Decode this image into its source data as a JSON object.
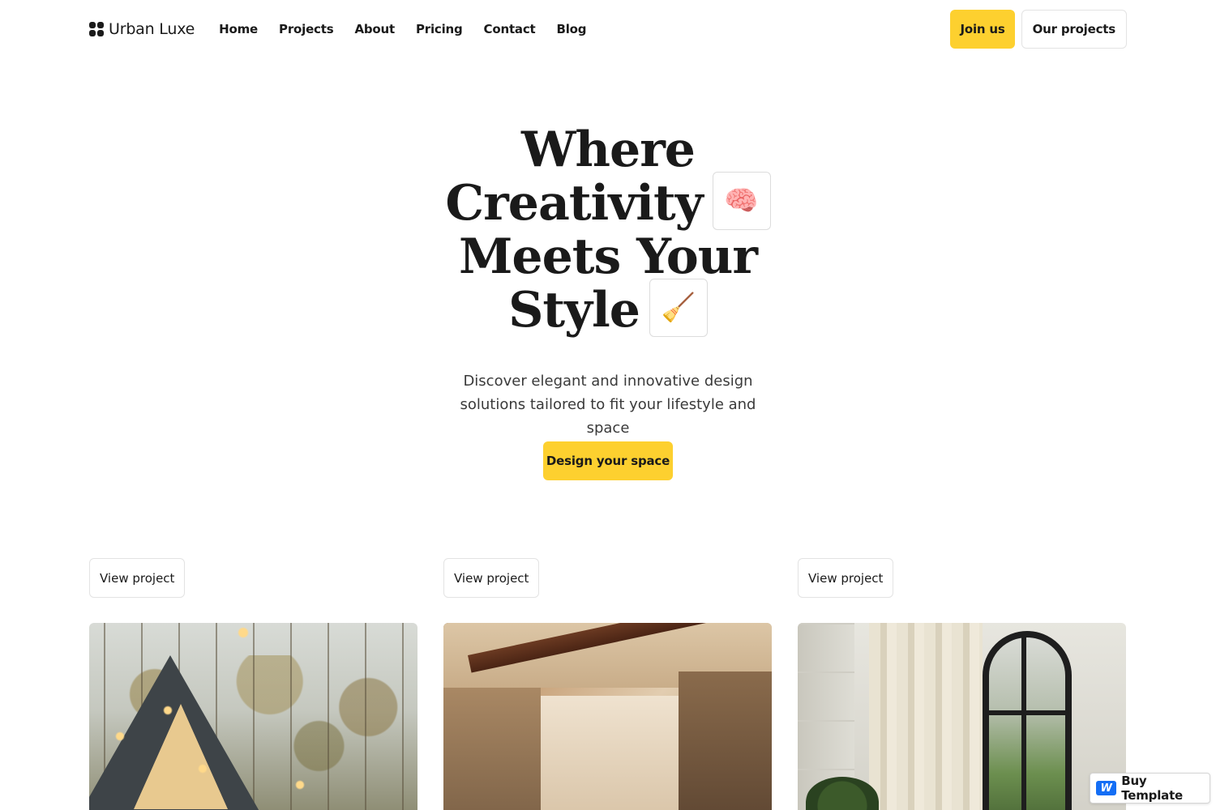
{
  "brand": {
    "name": "Urban Luxe",
    "icon": "four-squares-logo-icon"
  },
  "nav": {
    "items": [
      {
        "label": "Home"
      },
      {
        "label": "Projects"
      },
      {
        "label": "About"
      },
      {
        "label": "Pricing"
      },
      {
        "label": "Contact"
      },
      {
        "label": "Blog"
      }
    ]
  },
  "header_actions": {
    "join_label": "Join us",
    "projects_label": "Our projects"
  },
  "hero": {
    "title_lines": [
      "Where",
      "Creativity",
      "Meets Your",
      "Style"
    ],
    "emoji_1": "🧠",
    "emoji_2": "🧹",
    "subtitle": "Discover elegant and innovative design solutions tailored to fit your lifestyle and space",
    "cta_label": "Design your space"
  },
  "projects": [
    {
      "button_label": "View project",
      "image": "a-frame-cabin-photo"
    },
    {
      "button_label": "View project",
      "image": "warm-interior-photo"
    },
    {
      "button_label": "View project",
      "image": "arched-window-curtain-photo"
    }
  ],
  "badge": {
    "label": "Buy Template",
    "icon": "webflow-icon",
    "icon_glyph": "W"
  },
  "colors": {
    "accent": "#fdd02f",
    "text": "#1a1a1a",
    "border": "#e3e3e3",
    "badge_icon": "#146ef5"
  }
}
